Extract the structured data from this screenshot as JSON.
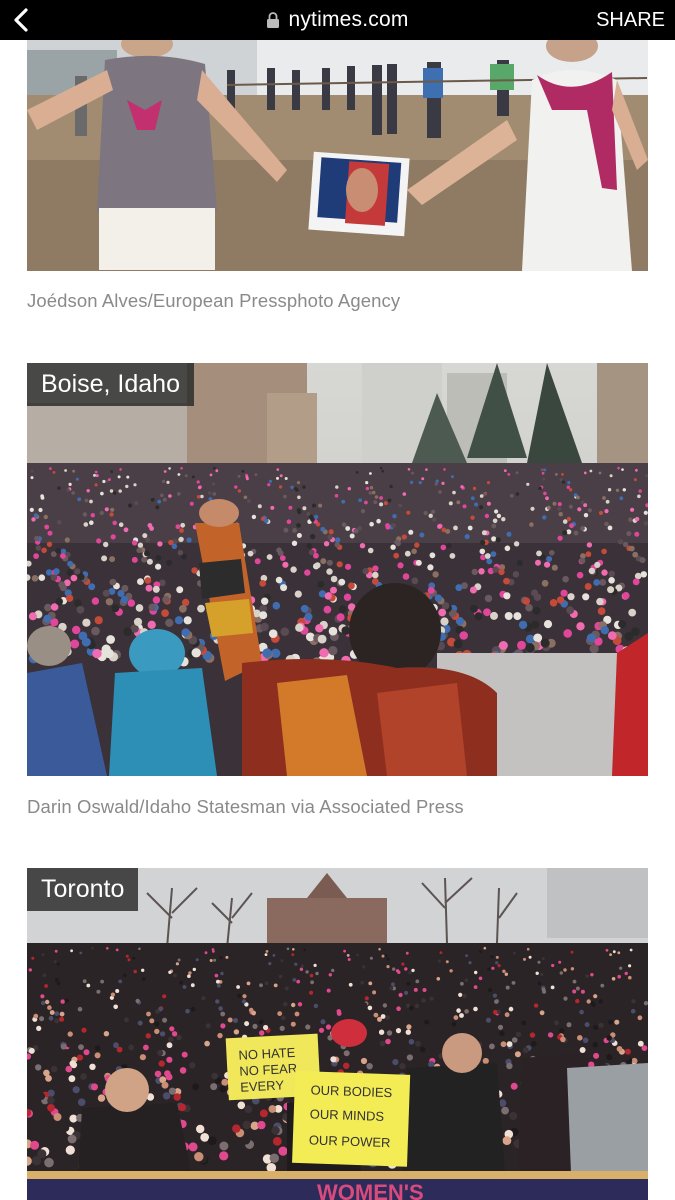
{
  "browser": {
    "url": "nytimes.com",
    "share_label": "SHARE",
    "back_icon": "chevron-left-icon",
    "lock_icon": "lock-icon"
  },
  "photos": [
    {
      "location": "",
      "credit": "Joédson Alves/European Pressphoto Agency",
      "sign_text": ""
    },
    {
      "location": "Boise, Idaho",
      "credit": "Darin Oswald/Idaho Statesman via Associated Press"
    },
    {
      "location": "Toronto",
      "signs": {
        "sign1": "NO HATE\nNO FEAR\nEVERY",
        "sign2": "OUR BODIES\nOUR MINDS\nOUR POWER",
        "banner": "WOMEN'S"
      }
    }
  ],
  "colors": {
    "topbar": "#000000",
    "credit_text": "#8a8a8a",
    "tag_bg": "#282828"
  }
}
